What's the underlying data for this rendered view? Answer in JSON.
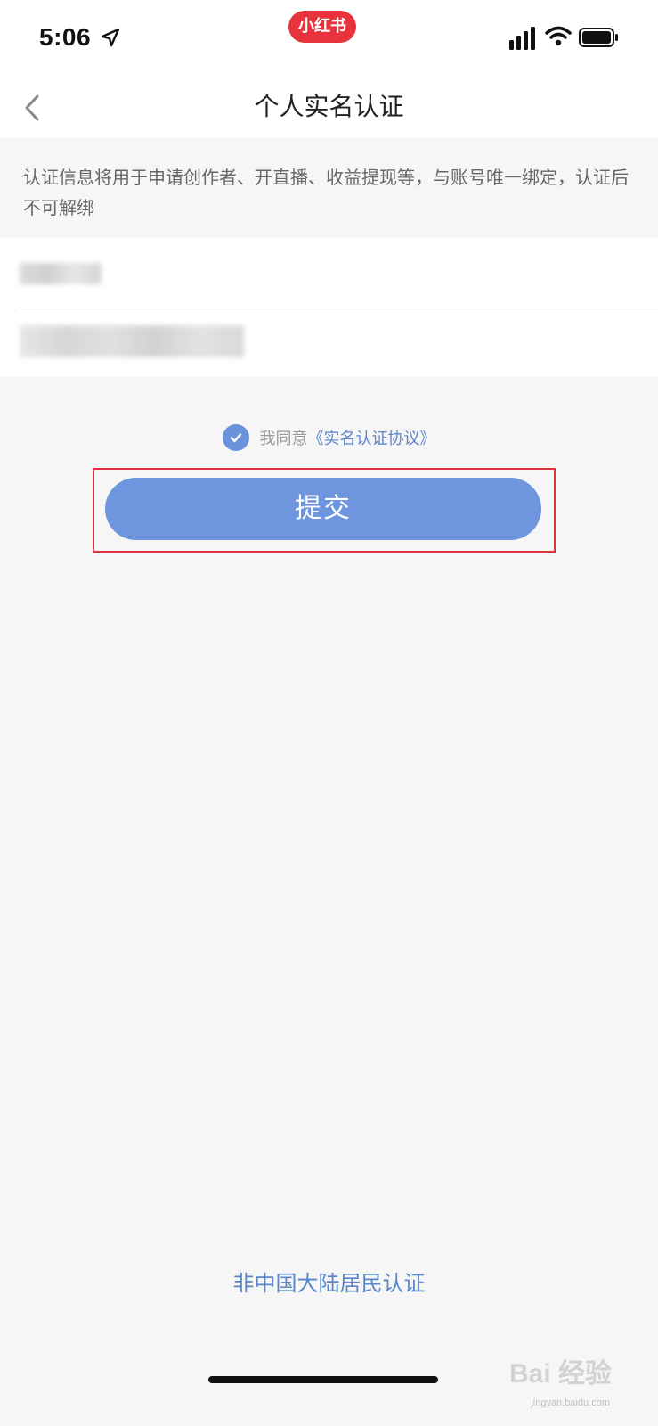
{
  "status_bar": {
    "time": "5:06",
    "app_badge": "小红书"
  },
  "nav": {
    "title": "个人实名认证"
  },
  "notice": {
    "text": "认证信息将用于申请创作者、开直播、收益提现等，与账号唯一绑定，认证后不可解绑"
  },
  "agreement": {
    "prefix": "我同意",
    "link": "《实名认证协议》",
    "checked": true
  },
  "submit": {
    "label": "提交"
  },
  "non_mainland": {
    "label": "非中国大陆居民认证"
  },
  "watermark": {
    "text": "Bai 经验",
    "url": "jingyan.baidu.com"
  },
  "colors": {
    "accent": "#6e96de",
    "link": "#5b86c8",
    "brand_red": "#e8333c",
    "highlight_border": "#e0313b"
  }
}
